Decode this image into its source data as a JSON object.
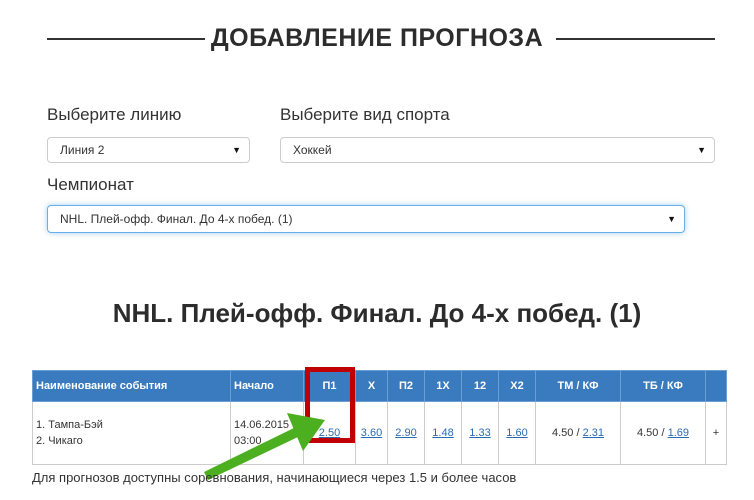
{
  "page": {
    "title": "ДОБАВЛЕНИЕ ПРОГНОЗА"
  },
  "form": {
    "line_label": "Выберите линию",
    "line_value": "Линия 2",
    "sport_label": "Выберите вид спорта",
    "sport_value": "Хоккей",
    "championship_label": "Чемпионат",
    "championship_value": "NHL. Плей-офф. Финал. До 4-х побед. (1)"
  },
  "event_section": {
    "title": "NHL. Плей-офф. Финал. До 4-х побед. (1)"
  },
  "table": {
    "headers": [
      "Наименование события",
      "Начало",
      "П1",
      "X",
      "П2",
      "1X",
      "12",
      "X2",
      "ТМ / КФ",
      "ТБ / КФ",
      ""
    ],
    "rows": [
      {
        "team1": "1. Тампа-Бэй",
        "team2": "2. Чикаго",
        "date": "14.06.2015",
        "time": "03:00",
        "p1": "2.50",
        "x": "3.60",
        "p2": "2.90",
        "x1": "1.48",
        "x12": "1.33",
        "x2": "1.60",
        "tm_total": "4.50 / ",
        "tm_coef": "2.31",
        "tb_total": "4.50 / ",
        "tb_coef": "1.69",
        "more": "+"
      }
    ]
  },
  "footnote": "Для прогнозов доступны соревнования, начинающиеся через 1.5 и более часов",
  "colors": {
    "header_bg": "#3a7bbf",
    "link": "#2a6cb3",
    "highlight": "#c00000",
    "arrow": "#4caf1f"
  }
}
